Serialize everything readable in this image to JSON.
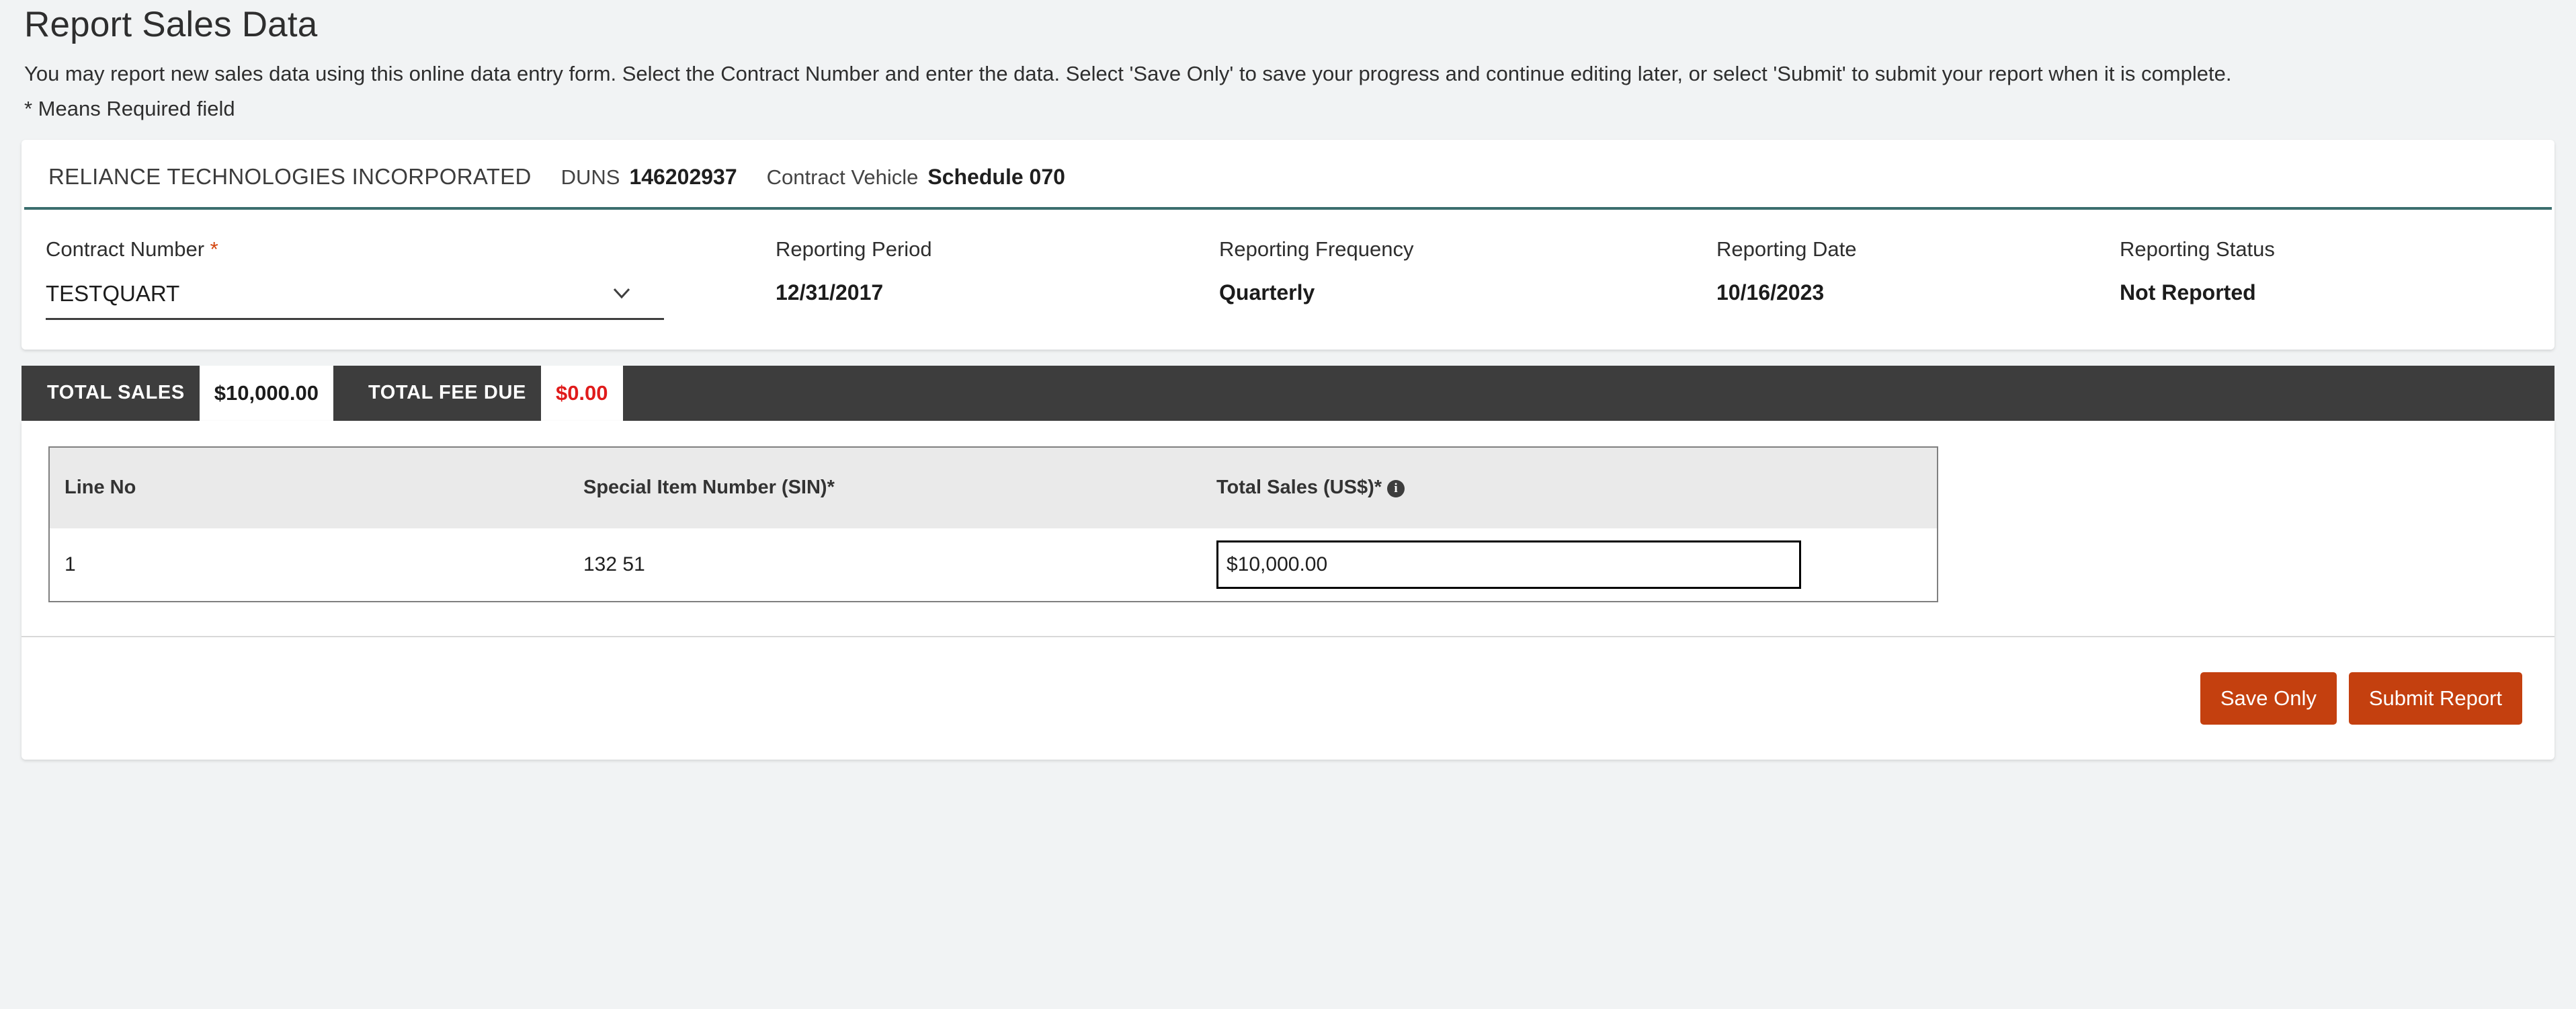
{
  "page": {
    "title": "Report Sales Data",
    "description": "You may report new sales data using this online data entry form. Select the Contract Number and enter the data. Select 'Save Only' to save your progress and continue editing later, or select 'Submit' to submit your report when it is complete.",
    "required_note": "* Means Required field"
  },
  "company": {
    "name": "RELIANCE TECHNOLOGIES INCORPORATED",
    "duns_label": "DUNS",
    "duns_value": "146202937",
    "vehicle_label": "Contract Vehicle",
    "vehicle_value": "Schedule 070"
  },
  "fields": {
    "contract_number": {
      "label": "Contract Number",
      "required_marker": "*",
      "value": "TESTQUART",
      "chevron_icon": "chevron-down-icon"
    },
    "reporting_period": {
      "label": "Reporting Period",
      "value": "12/31/2017"
    },
    "reporting_frequency": {
      "label": "Reporting Frequency",
      "value": "Quarterly"
    },
    "reporting_date": {
      "label": "Reporting Date",
      "value": "10/16/2023"
    },
    "reporting_status": {
      "label": "Reporting Status",
      "value": "Not Reported"
    }
  },
  "totals": {
    "sales_label": "TOTAL SALES",
    "sales_value": "$10,000.00",
    "fee_label": "TOTAL FEE DUE",
    "fee_value": "$0.00",
    "fee_color": "#e01b1b"
  },
  "table": {
    "columns": [
      "Line No",
      "Special Item Number (SIN)*",
      "Total Sales (US$)*"
    ],
    "info_icon": "info-icon",
    "rows": [
      {
        "line_no": "1",
        "sin": "132 51",
        "total_sales": "$10,000.00"
      }
    ]
  },
  "actions": {
    "save_label": "Save Only",
    "submit_label": "Submit Report",
    "button_color": "#c4400f"
  },
  "theme": {
    "background": "#f1f3f4",
    "accent_teal": "#3b6e6e",
    "dark_bar": "#3d3d3d",
    "required_star": "#d4460f"
  }
}
